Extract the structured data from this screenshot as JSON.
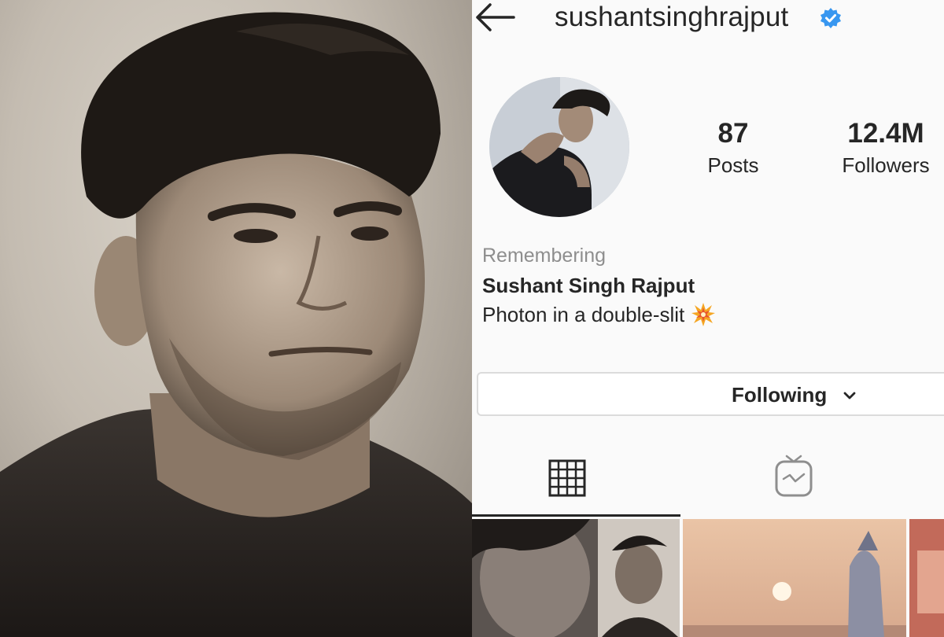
{
  "profile": {
    "username": "sushantsinghrajput",
    "verified_icon": "verified-badge-icon",
    "stats": {
      "posts_count": "87",
      "posts_label": "Posts",
      "followers_count": "12.4M",
      "followers_label": "Followers"
    },
    "bio": {
      "remembering": "Remembering",
      "full_name": "Sushant Singh Rajput",
      "text": "Photon in a double-slit"
    },
    "follow_button": {
      "label": "Following"
    },
    "tabs": [
      "grid-tab",
      "igtv-tab"
    ]
  },
  "colors": {
    "verified": "#3897f0",
    "secondary_text": "#8e8e8e",
    "primary_text": "#262626",
    "border": "#dbdbdb",
    "background": "#fafafa"
  }
}
